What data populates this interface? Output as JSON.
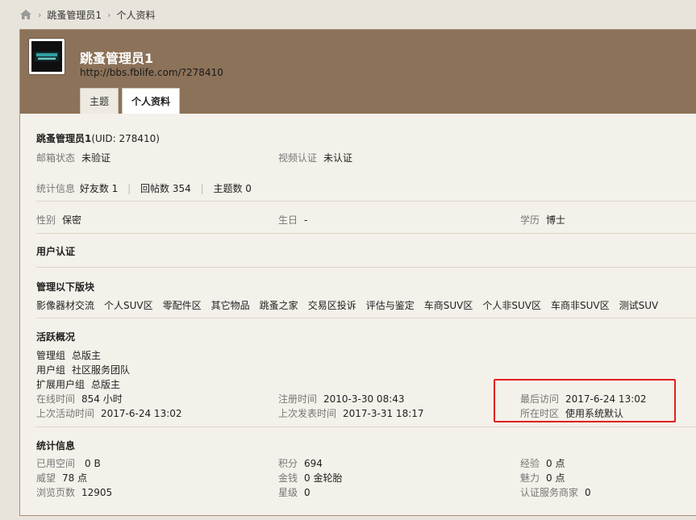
{
  "breadcrumb": {
    "items": [
      "跳蚤管理员1",
      "个人资料"
    ]
  },
  "header": {
    "username": "跳蚤管理员1",
    "url": "http://bbs.fblife.com/?278410",
    "tabs": [
      {
        "label": "主题",
        "active": false
      },
      {
        "label": "个人资料",
        "active": true
      }
    ]
  },
  "profile": {
    "title_name": "跳蚤管理员1",
    "uid_text": "(UID: 278410)",
    "email_label": "邮箱状态",
    "email_value": "未验证",
    "video_label": "视频认证",
    "video_value": "未认证",
    "stats_label": "统计信息",
    "friends": "好友数 1",
    "replies": "回帖数 354",
    "threads": "主题数 0",
    "gender_label": "性别",
    "gender_value": "保密",
    "birthday_label": "生日",
    "birthday_value": "-",
    "edu_label": "学历",
    "edu_value": "博士"
  },
  "user_auth": {
    "title": "用户认证"
  },
  "managed": {
    "title": "管理以下版块",
    "forums": [
      "影像器材交流",
      "个人SUV区",
      "零配件区",
      "其它物品",
      "跳蚤之家",
      "交易区投诉",
      "评估与鉴定",
      "车商SUV区",
      "个人非SUV区",
      "车商非SUV区",
      "测试SUV"
    ]
  },
  "activity": {
    "title": "活跃概况",
    "admin_group_label": "管理组",
    "admin_group_value": "总版主",
    "user_group_label": "用户组",
    "user_group_value": "社区服务团队",
    "ext_group_label": "扩展用户组",
    "ext_group_value": "总版主",
    "online_label": "在线时间",
    "online_value": "854 小时",
    "reg_label": "注册时间",
    "reg_value": "2010-3-30 08:43",
    "last_visit_label": "最后访问",
    "last_visit_value": "2017-6-24 13:02",
    "last_active_label": "上次活动时间",
    "last_active_value": "2017-6-24 13:02",
    "last_post_label": "上次发表时间",
    "last_post_value": "2017-3-31 18:17",
    "tz_label": "所在时区",
    "tz_value": "使用系统默认"
  },
  "stats": {
    "title": "统计信息",
    "space_label": "已用空间",
    "space_value": "0 B",
    "points_label": "积分",
    "points_value": "694",
    "exp_label": "经验",
    "exp_value": "0 点",
    "prestige_label": "威望",
    "prestige_value": "78 点",
    "money_label": "金钱",
    "money_value": "0 金轮胎",
    "charm_label": "魅力",
    "charm_value": "0 点",
    "views_label": "浏览页数",
    "views_value": "12905",
    "stars_label": "星级",
    "stars_value": "0",
    "merchant_label": "认证服务商家",
    "merchant_value": "0"
  },
  "colors": {
    "header_bg": "#8c7259",
    "page_bg": "#e8e4db",
    "highlight": "#e11f1f"
  }
}
